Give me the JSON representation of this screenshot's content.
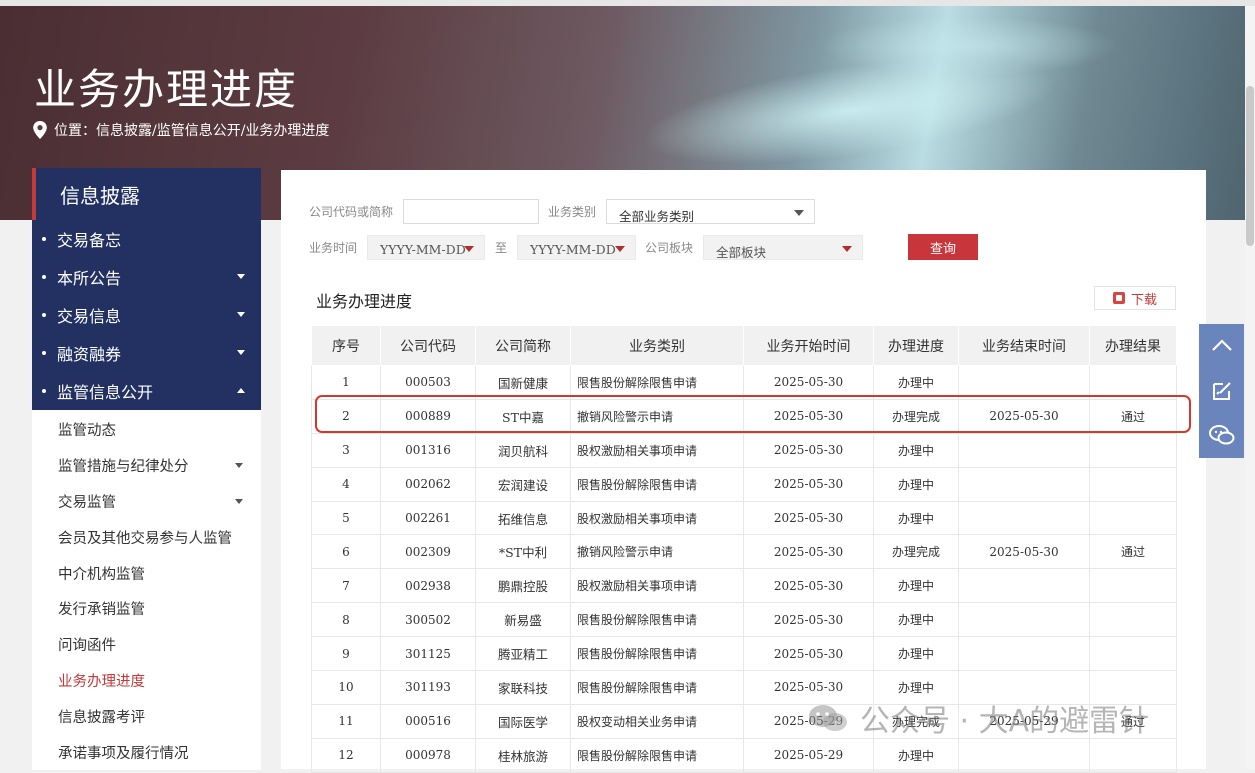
{
  "page": {
    "title": "业务办理进度",
    "breadcrumb": "位置：信息披露/监管信息公开/业务办理进度"
  },
  "sidebar": {
    "header": "信息披露",
    "main_items": [
      {
        "label": "交易备忘"
      },
      {
        "label": "本所公告"
      },
      {
        "label": "交易信息"
      },
      {
        "label": "融资融券"
      },
      {
        "label": "监管信息公开"
      }
    ],
    "sub_items": [
      {
        "label": "监管动态"
      },
      {
        "label": "监管措施与纪律处分"
      },
      {
        "label": "交易监管"
      },
      {
        "label": "会员及其他交易参与人监管"
      },
      {
        "label": "中介机构监管"
      },
      {
        "label": "发行承销监管"
      },
      {
        "label": "问询函件"
      },
      {
        "label": "业务办理进度"
      },
      {
        "label": "信息披露考评"
      },
      {
        "label": "承诺事项及履行情况"
      }
    ]
  },
  "filters": {
    "company_label": "公司代码或简称",
    "company_value": "",
    "category_label": "业务类别",
    "category_value": "全部业务类别",
    "time_label": "业务时间",
    "date_from": "YYYY-MM-DD",
    "to_label": "至",
    "date_to": "YYYY-MM-DD",
    "board_label": "公司板块",
    "board_value": "全部板块",
    "query_button": "查询"
  },
  "section": {
    "title": "业务办理进度",
    "download_button": "下载"
  },
  "table": {
    "headers": [
      "序号",
      "公司代码",
      "公司简称",
      "业务类别",
      "业务开始时间",
      "办理进度",
      "业务结束时间",
      "办理结果"
    ],
    "rows": [
      [
        "1",
        "000503",
        "国新健康",
        "限售股份解除限售申请",
        "2025-05-30",
        "办理中",
        "",
        ""
      ],
      [
        "2",
        "000889",
        "ST中嘉",
        "撤销风险警示申请",
        "2025-05-30",
        "办理完成",
        "2025-05-30",
        "通过"
      ],
      [
        "3",
        "001316",
        "润贝航科",
        "股权激励相关事项申请",
        "2025-05-30",
        "办理中",
        "",
        ""
      ],
      [
        "4",
        "002062",
        "宏润建设",
        "限售股份解除限售申请",
        "2025-05-30",
        "办理中",
        "",
        ""
      ],
      [
        "5",
        "002261",
        "拓维信息",
        "股权激励相关事项申请",
        "2025-05-30",
        "办理中",
        "",
        ""
      ],
      [
        "6",
        "002309",
        "*ST中利",
        "撤销风险警示申请",
        "2025-05-30",
        "办理完成",
        "2025-05-30",
        "通过"
      ],
      [
        "7",
        "002938",
        "鹏鼎控股",
        "股权激励相关事项申请",
        "2025-05-30",
        "办理中",
        "",
        ""
      ],
      [
        "8",
        "300502",
        "新易盛",
        "限售股份解除限售申请",
        "2025-05-30",
        "办理中",
        "",
        ""
      ],
      [
        "9",
        "301125",
        "腾亚精工",
        "限售股份解除限售申请",
        "2025-05-30",
        "办理中",
        "",
        ""
      ],
      [
        "10",
        "301193",
        "家联科技",
        "限售股份解除限售申请",
        "2025-05-30",
        "办理中",
        "",
        ""
      ],
      [
        "11",
        "000516",
        "国际医学",
        "股权变动相关业务申请",
        "2025-05-29",
        "办理完成",
        "2025-05-29",
        "通过"
      ],
      [
        "12",
        "000978",
        "桂林旅游",
        "限售股份解除限售申请",
        "2025-05-29",
        "办理中",
        "",
        ""
      ]
    ],
    "highlighted_row": 2
  },
  "watermark": {
    "text": "公众号 · 大A的避雷针"
  },
  "colors": {
    "navy": "#223162",
    "accent_red": "#c8353a",
    "float_bar": "#6a84bc"
  },
  "icons": {
    "breadcrumb": "location-pin-icon",
    "download": "pdf-download-icon",
    "float": [
      "chevron-up-icon",
      "edit-icon",
      "wechat-icon"
    ]
  }
}
